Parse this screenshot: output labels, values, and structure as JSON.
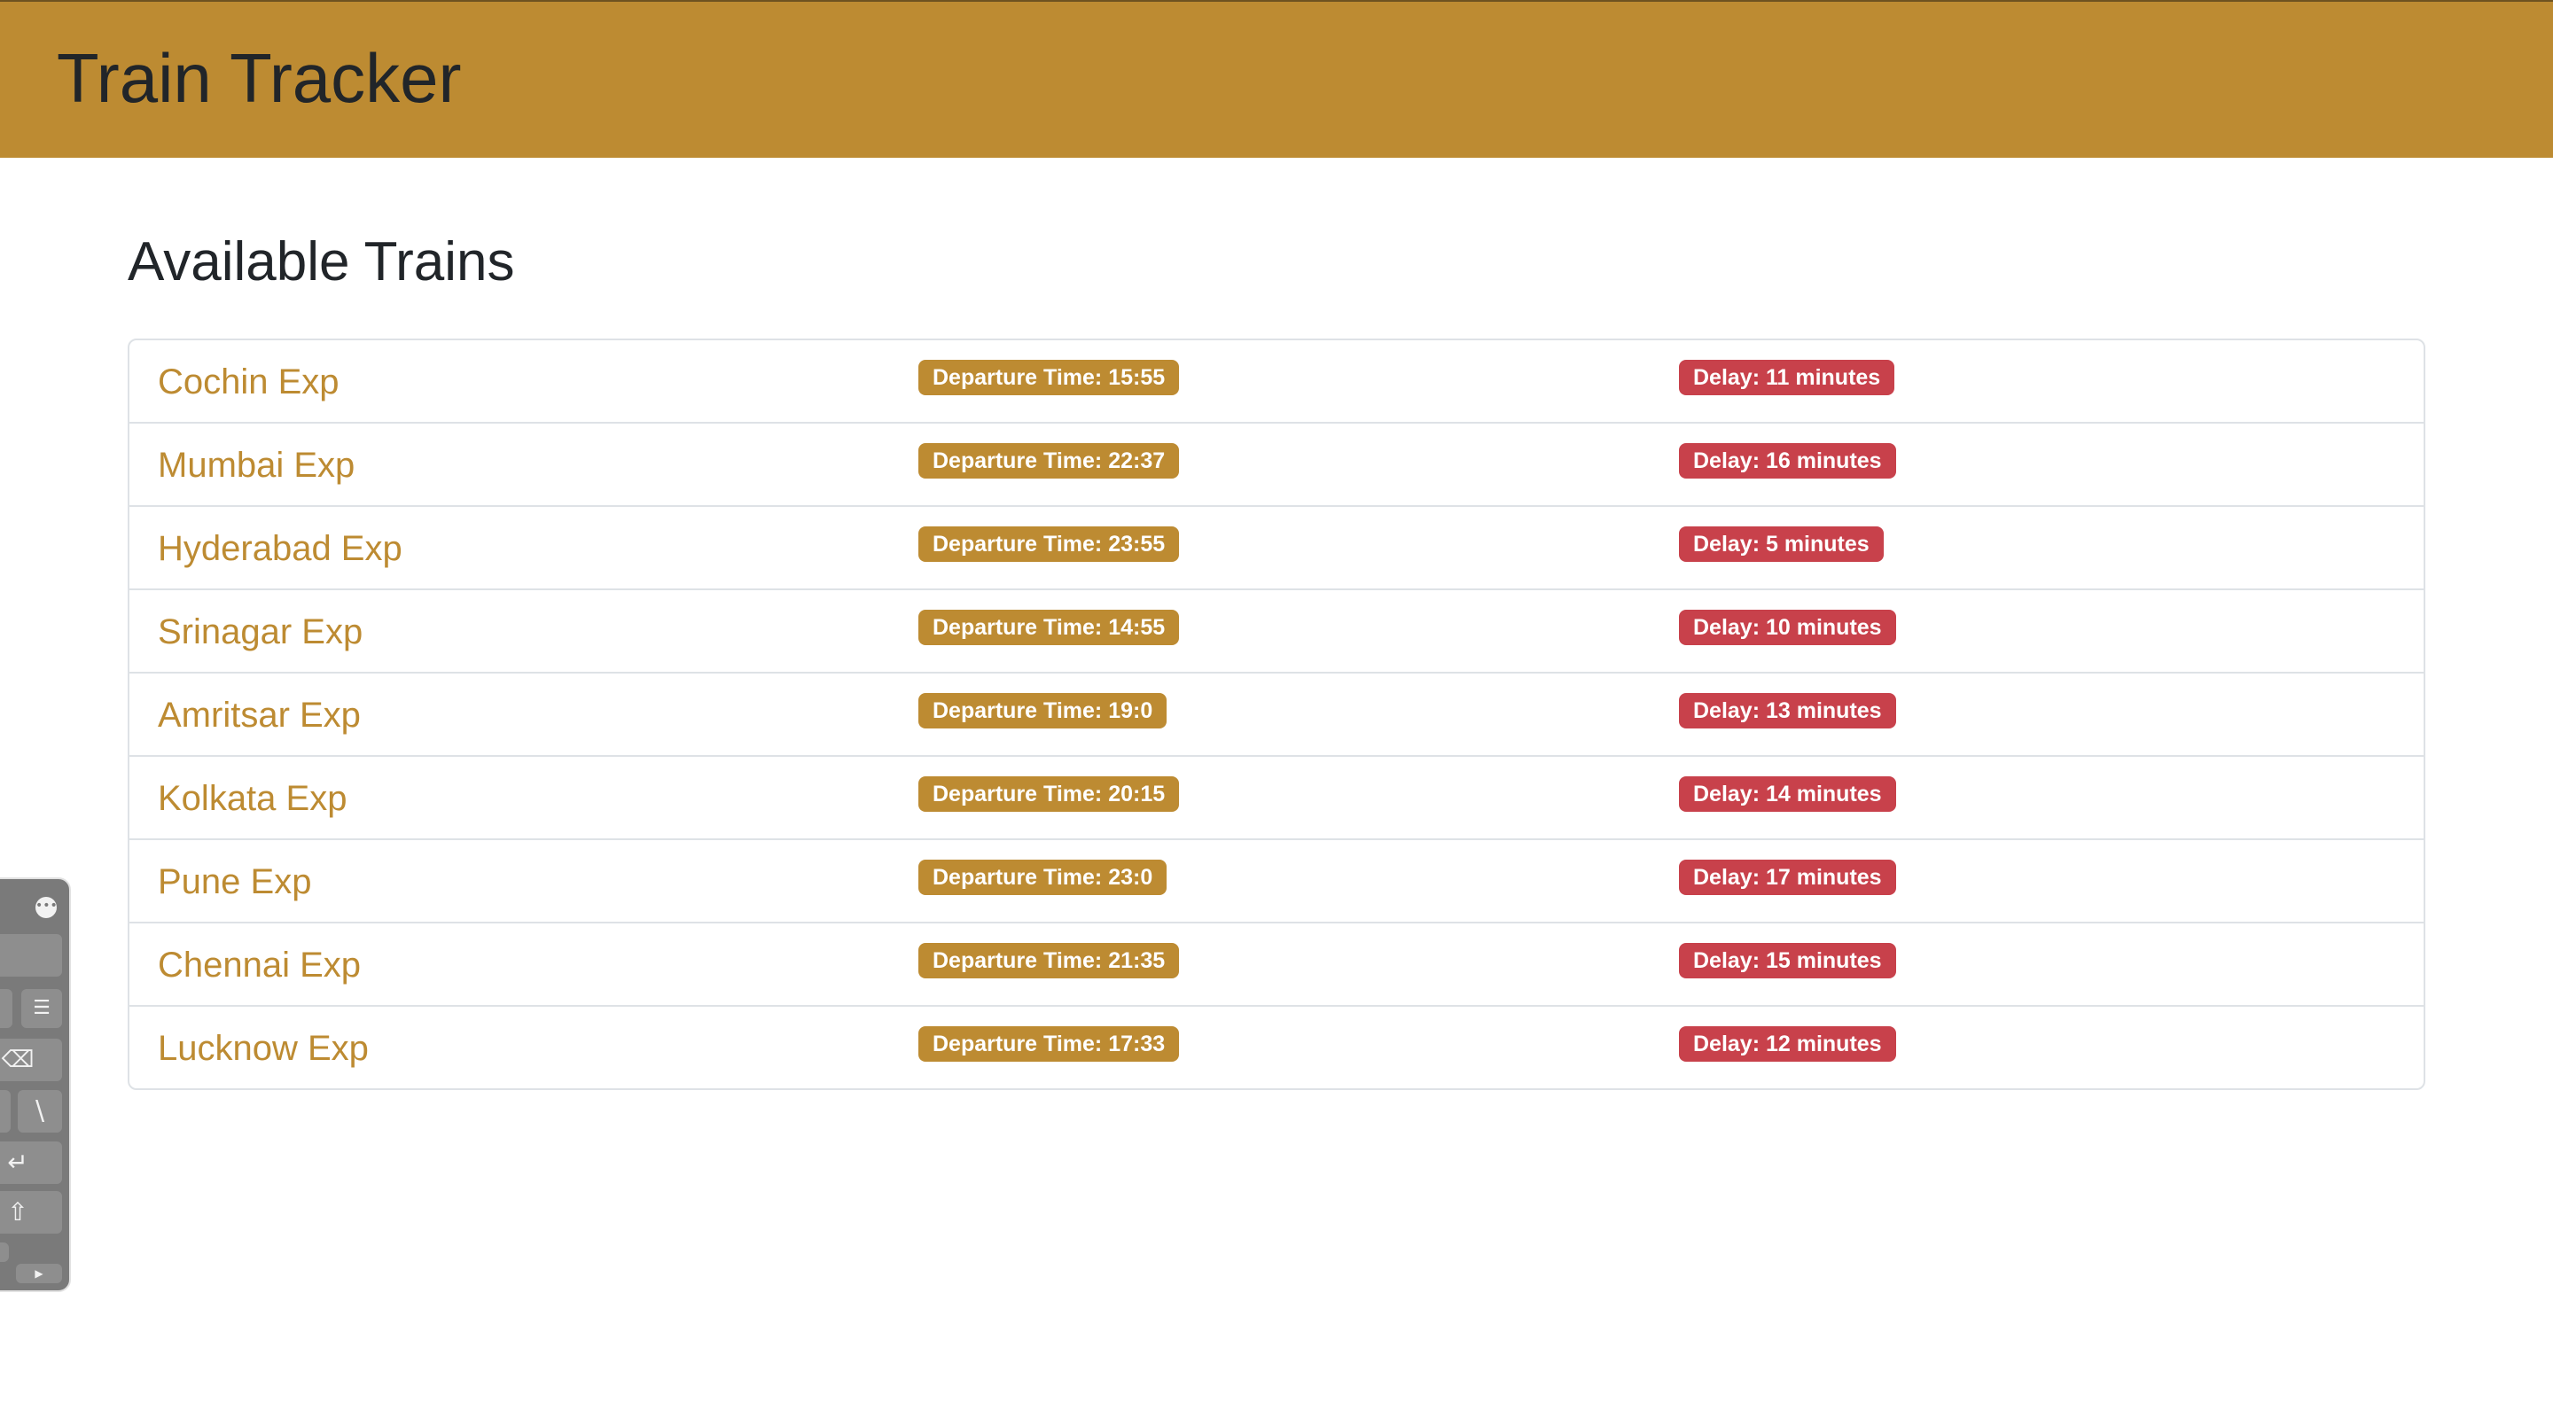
{
  "header": {
    "title": "Train Tracker",
    "background_color": "#bd8b32"
  },
  "main": {
    "heading": "Available Trains",
    "trains": [
      {
        "name": "Cochin Exp",
        "departure": "Departure Time: 15:55",
        "delay": "Delay: 11 minutes"
      },
      {
        "name": "Mumbai Exp",
        "departure": "Departure Time: 22:37",
        "delay": "Delay: 16 minutes"
      },
      {
        "name": "Hyderabad Exp",
        "departure": "Departure Time: 23:55",
        "delay": "Delay: 5 minutes"
      },
      {
        "name": "Srinagar Exp",
        "departure": "Departure Time: 14:55",
        "delay": "Delay: 10 minutes"
      },
      {
        "name": "Amritsar Exp",
        "departure": "Departure Time: 19:0",
        "delay": "Delay: 13 minutes"
      },
      {
        "name": "Kolkata Exp",
        "departure": "Departure Time: 20:15",
        "delay": "Delay: 14 minutes"
      },
      {
        "name": "Pune Exp",
        "departure": "Departure Time: 23:0",
        "delay": "Delay: 17 minutes"
      },
      {
        "name": "Chennai Exp",
        "departure": "Departure Time: 21:35",
        "delay": "Delay: 15 minutes"
      },
      {
        "name": "Lucknow Exp",
        "departure": "Departure Time: 17:33",
        "delay": "Delay: 12 minutes"
      }
    ]
  },
  "colors": {
    "accent": "#bd8b32",
    "delay_badge": "#c8414b",
    "text": "#212529"
  },
  "keyboard_panel": {
    "icons": [
      "more-icon",
      "list-icon",
      "delete-icon",
      "backslash-key",
      "return-icon",
      "shift-icon",
      "play-icon"
    ]
  }
}
